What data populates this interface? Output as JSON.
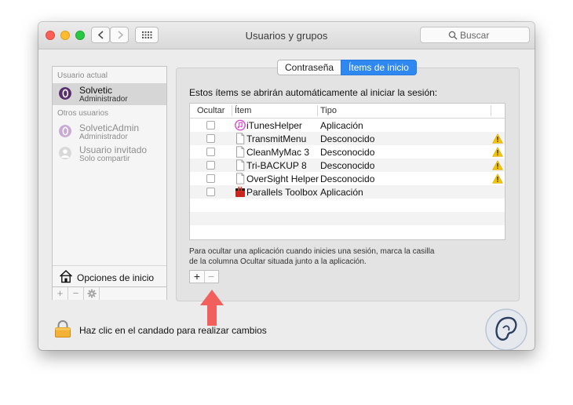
{
  "window": {
    "title": "Usuarios y grupos",
    "search_placeholder": "Buscar"
  },
  "sidebar": {
    "current_user_heading": "Usuario actual",
    "current_user": {
      "name": "Solvetic",
      "role": "Administrador"
    },
    "other_users_heading": "Otros usuarios",
    "other_users": [
      {
        "name": "SolveticAdmin",
        "role": "Administrador"
      },
      {
        "name": "Usuario invitado",
        "role": "Solo compartir"
      }
    ],
    "login_options": "Opciones de inicio",
    "toolbar": {
      "add": "+",
      "remove": "−"
    }
  },
  "tabs": [
    {
      "label": "Contraseña",
      "active": false
    },
    {
      "label": "Ítems de inicio",
      "active": true
    }
  ],
  "main": {
    "intro": "Estos ítems se abrirán automáticamente al iniciar la sesión:",
    "columns": {
      "hide": "Ocultar",
      "item": "Ítem",
      "type": "Tipo"
    },
    "items": [
      {
        "name": "iTunesHelper",
        "type": "Aplicación",
        "warning": false,
        "hidden": false,
        "icon": "itunes-icon"
      },
      {
        "name": "TransmitMenu",
        "type": "Desconocido",
        "warning": true,
        "hidden": false,
        "icon": "document-icon"
      },
      {
        "name": "CleanMyMac 3",
        "type": "Desconocido",
        "warning": true,
        "hidden": false,
        "icon": "document-icon"
      },
      {
        "name": "Tri-BACKUP 8",
        "type": "Desconocido",
        "warning": true,
        "hidden": false,
        "icon": "document-icon"
      },
      {
        "name": "OverSight Helper",
        "type": "Desconocido",
        "warning": true,
        "hidden": false,
        "icon": "document-icon"
      },
      {
        "name": "Parallels Toolbox",
        "type": "Aplicación",
        "warning": false,
        "hidden": false,
        "icon": "parallels-icon"
      }
    ],
    "hint_line1": "Para ocultar una aplicación cuando inicies una sesión, marca la casilla",
    "hint_line2": "de la columna Ocultar situada junto a la aplicación.",
    "add_label": "+",
    "remove_label": "−"
  },
  "footer": {
    "lock_text": "Haz clic en el candado para realizar cambios"
  },
  "colors": {
    "accent": "#2f87f0",
    "warning": "#f5c400",
    "arrow": "#f2605d"
  }
}
